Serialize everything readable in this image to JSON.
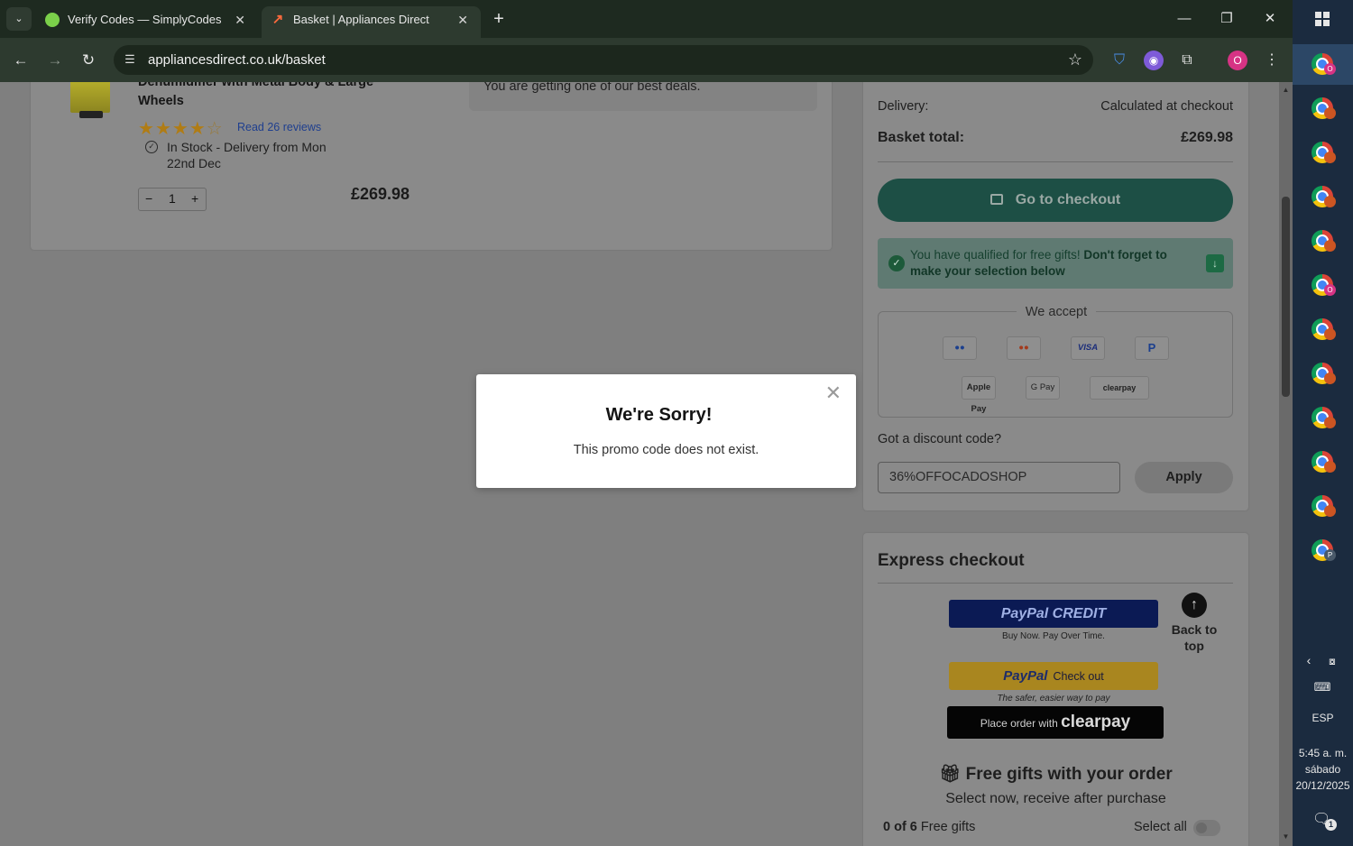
{
  "browser": {
    "tabs": [
      {
        "title": "Verify Codes — SimplyCodes",
        "active": false
      },
      {
        "title": "Basket | Appliances Direct",
        "active": true
      }
    ],
    "url": "appliancesdirect.co.uk/basket",
    "profile_initial": "O"
  },
  "product": {
    "name": "Dehumidifier with Metal Body & Large Wheels",
    "rating_stars": 4,
    "rating_max": 5,
    "reviews_link": "Read 26 reviews",
    "stock": "In Stock - Delivery from Mon 22nd Dec",
    "quantity": "1",
    "price": "£269.98",
    "deal_text": "You are getting one of our best deals."
  },
  "summary": {
    "delivery_label": "Delivery:",
    "delivery_value": "Calculated at checkout",
    "total_label": "Basket total:",
    "total_value": "£269.98",
    "checkout_label": "Go to checkout",
    "gift_notice": "You have qualified for free gifts!",
    "gift_notice_bold": "Don't forget to make your selection below",
    "we_accept": "We accept",
    "payment_methods": [
      "Maestro",
      "Mastercard",
      "VISA",
      "PayPal",
      "Apple Pay",
      "G Pay",
      "clearpay"
    ],
    "discount_label": "Got a discount code?",
    "discount_value": "36%OFFOCADOSHOP",
    "apply_label": "Apply"
  },
  "express": {
    "title": "Express checkout",
    "paypal_credit": "PayPal CREDIT",
    "paypal_credit_sub": "Buy Now. Pay Over Time.",
    "paypal_brand": "PayPal",
    "paypal_checkout": "Check out",
    "paypal_checkout_sub": "The safer, easier way to pay",
    "clearpay_prefix": "Place order with",
    "clearpay_brand": "clearpay",
    "back_to_top": "Back to top",
    "free_gifts_title": "Free gifts with your order",
    "free_gifts_sub": "Select now, receive after purchase",
    "gift_count_bold": "0 of 6",
    "gift_count_text": "Free gifts",
    "select_all": "Select all"
  },
  "modal": {
    "title": "We're Sorry!",
    "message": "This promo code does not exist."
  },
  "taskbar": {
    "language": "ESP",
    "time": "5:45 a. m.",
    "day": "sábado",
    "date": "20/12/2025",
    "notifications": "1",
    "chrome_badges": [
      "O",
      "",
      "",
      "",
      "",
      "O",
      "",
      "",
      "",
      "",
      "",
      "P"
    ]
  }
}
